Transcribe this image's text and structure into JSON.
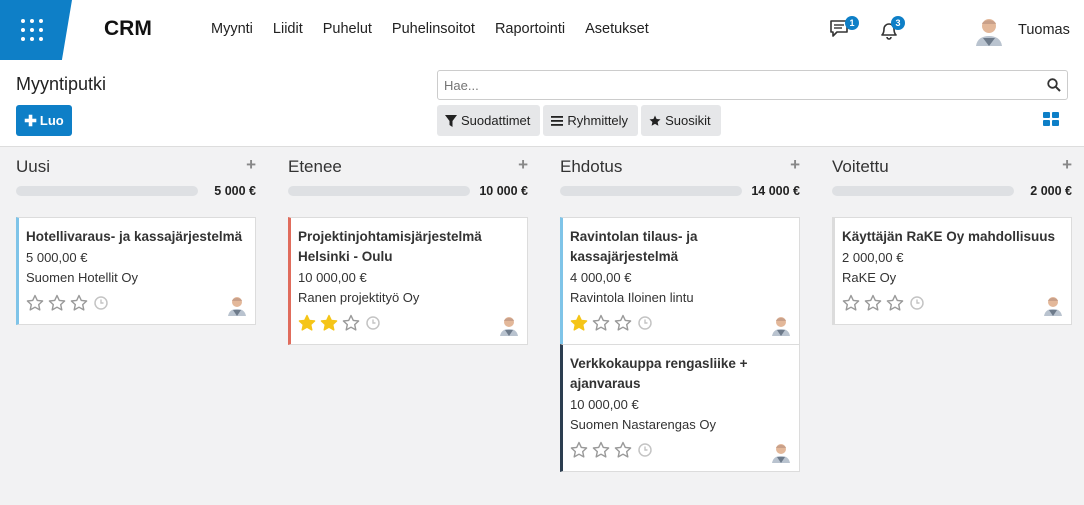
{
  "topbar": {
    "brand": "CRM",
    "menu": [
      "Myynti",
      "Liidit",
      "Puhelut",
      "Puhelinsoitot",
      "Raportointi",
      "Asetukset"
    ],
    "messages_count": "1",
    "notifications_count": "3",
    "user_name": "Tuomas"
  },
  "control": {
    "title": "Myyntiputki",
    "create_label": "Luo",
    "search_placeholder": "Hae...",
    "filters_label": "Suodattimet",
    "group_label": "Ryhmittely",
    "favorites_label": "Suosikit"
  },
  "colors": {
    "accent": "#0e7fc7",
    "star_on": "#f5c518",
    "star_off": "#999999"
  },
  "columns": [
    {
      "title": "Uusi",
      "total": "5 000 €",
      "cards": [
        {
          "title": "Hotellivaraus- ja kassajärjestelmä",
          "amount": "5 000,00 €",
          "company": "Suomen Hotellit Oy",
          "stars": 0,
          "color": "#7fc4e8"
        }
      ]
    },
    {
      "title": "Etenee",
      "total": "10 000 €",
      "cards": [
        {
          "title": "Projektinjohtamisjärjestelmä Helsinki - Oulu",
          "amount": "10 000,00 €",
          "company": "Ranen projektityö Oy",
          "stars": 2,
          "color": "#e06c5c"
        }
      ]
    },
    {
      "title": "Ehdotus",
      "total": "14 000 €",
      "cards": [
        {
          "title": "Ravintolan tilaus- ja kassajärjestelmä",
          "amount": "4 000,00 €",
          "company": "Ravintola Iloinen lintu",
          "stars": 1,
          "color": "#7fc4e8"
        },
        {
          "title": "Verkkokauppa rengasliike + ajanvaraus",
          "amount": "10 000,00 €",
          "company": "Suomen Nastarengas Oy",
          "stars": 0,
          "color": "#2c3e50"
        }
      ]
    },
    {
      "title": "Voitettu",
      "total": "2 000 €",
      "cards": [
        {
          "title": "Käyttäjän RaKE Oy mahdollisuus",
          "amount": "2 000,00 €",
          "company": "RaKE Oy",
          "stars": 0,
          "color": "#dcdcdc"
        }
      ]
    }
  ]
}
